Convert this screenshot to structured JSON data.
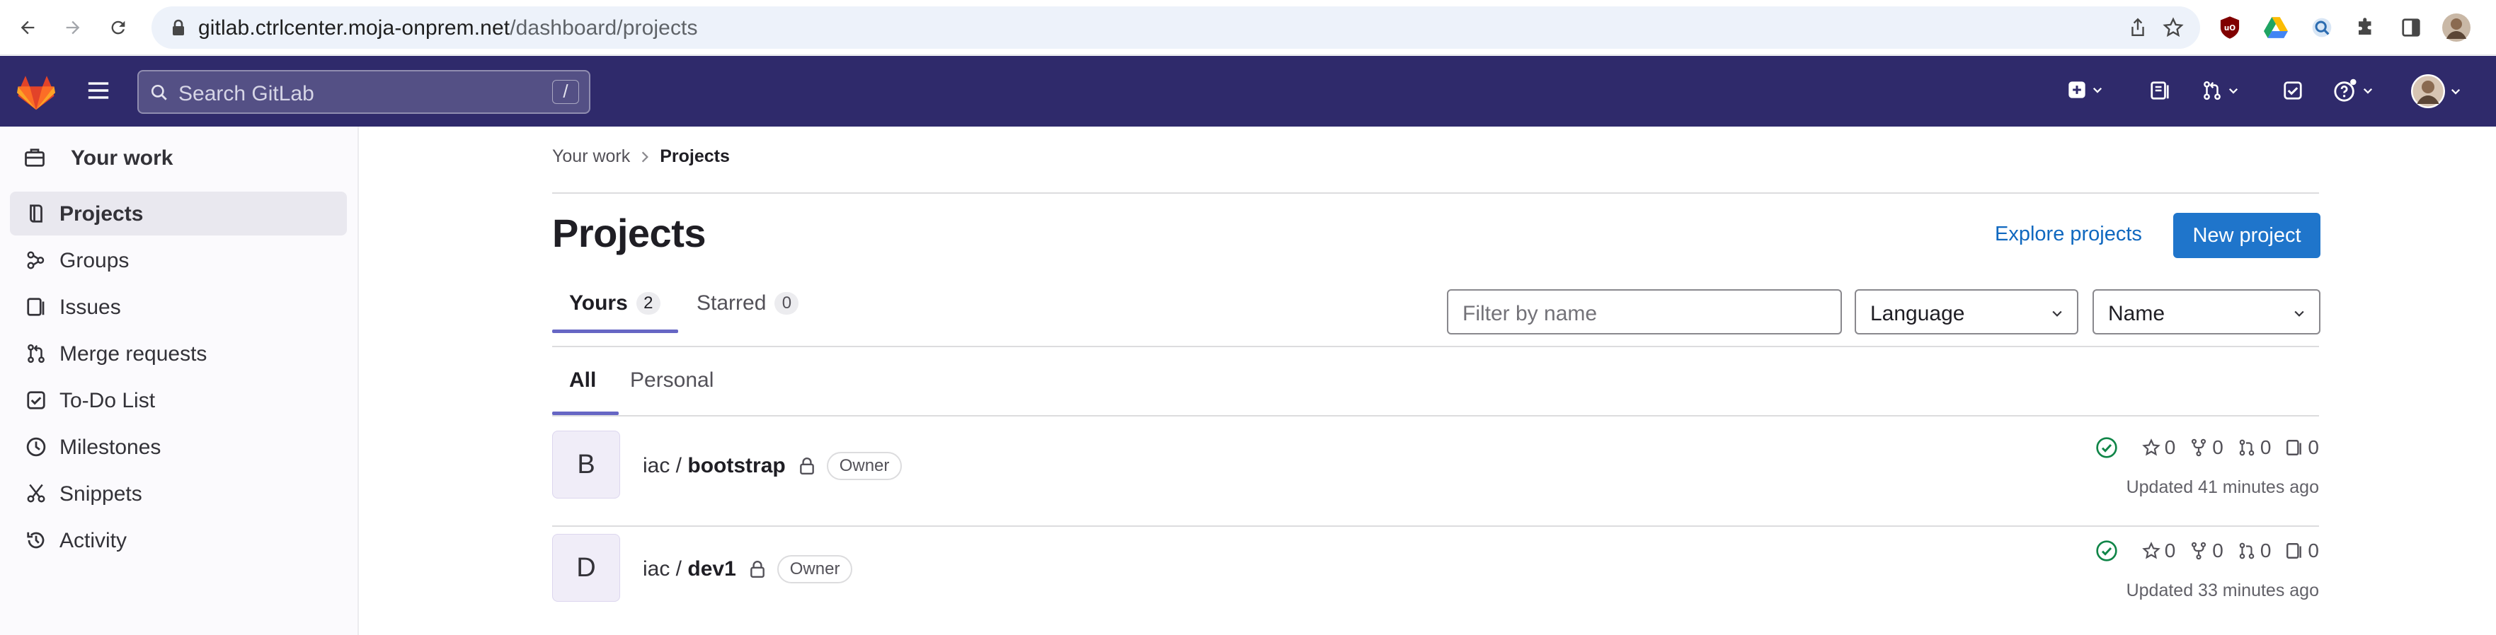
{
  "browser": {
    "url_host": "gitlab.ctrlcenter.moja-onprem.net",
    "url_path": "/dashboard/projects"
  },
  "topnav": {
    "search_placeholder": "Search GitLab",
    "search_shortcut": "/"
  },
  "sidebar": {
    "context_label": "Your work",
    "items": [
      {
        "label": "Projects",
        "icon": "project-icon",
        "active": true
      },
      {
        "label": "Groups",
        "icon": "group-icon"
      },
      {
        "label": "Issues",
        "icon": "issues-icon"
      },
      {
        "label": "Merge requests",
        "icon": "merge-request-icon"
      },
      {
        "label": "To-Do List",
        "icon": "todo-icon"
      },
      {
        "label": "Milestones",
        "icon": "clock-icon"
      },
      {
        "label": "Snippets",
        "icon": "scissors-icon"
      },
      {
        "label": "Activity",
        "icon": "history-icon"
      }
    ]
  },
  "main": {
    "breadcrumb": {
      "parent": "Your work",
      "current": "Projects"
    },
    "title": "Projects",
    "explore_label": "Explore projects",
    "new_project_label": "New project",
    "tabs": [
      {
        "label": "Yours",
        "count": "2",
        "active": true
      },
      {
        "label": "Starred",
        "count": "0"
      }
    ],
    "subtabs": [
      {
        "label": "All",
        "active": true
      },
      {
        "label": "Personal"
      }
    ],
    "filter_placeholder": "Filter by name",
    "language_select": "Language",
    "sort_select": "Name",
    "projects": [
      {
        "avatar_letter": "B",
        "namespace": "iac / ",
        "name": "bootstrap",
        "role": "Owner",
        "stars": "0",
        "forks": "0",
        "merge_requests": "0",
        "issues": "0",
        "updated": "Updated 41 minutes ago"
      },
      {
        "avatar_letter": "D",
        "namespace": "iac / ",
        "name": "dev1",
        "role": "Owner",
        "stars": "0",
        "forks": "0",
        "merge_requests": "0",
        "issues": "0",
        "updated": "Updated 33 minutes ago"
      }
    ]
  },
  "colors": {
    "topnav_bg": "#2f2a6b",
    "primary_button": "#1f75cb",
    "link": "#1068bf",
    "pipeline_success": "#108548",
    "tab_underline": "#6666c4"
  }
}
